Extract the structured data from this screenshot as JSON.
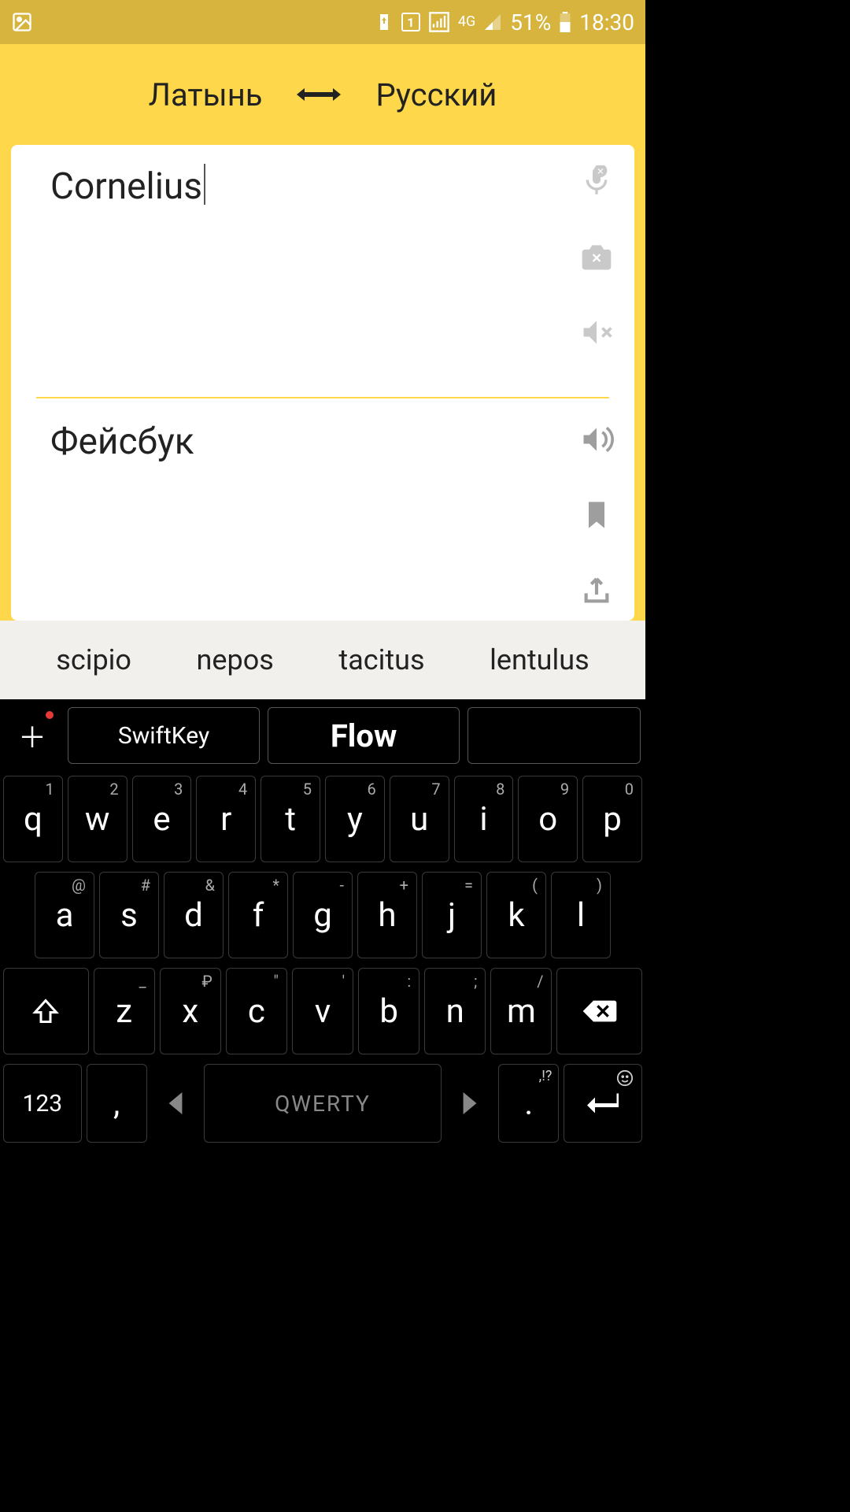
{
  "status": {
    "battery_pct": "51%",
    "time": "18:30",
    "network": "4G",
    "sim": "1"
  },
  "header": {
    "source_lang": "Латынь",
    "target_lang": "Русский"
  },
  "source": {
    "text": "Cornelius"
  },
  "target": {
    "text": "Фейсбук"
  },
  "suggestions": [
    "scipio",
    "nepos",
    "tacitus",
    "lentulus"
  ],
  "kb_top": {
    "brand": "SwiftKey",
    "mode": "Flow"
  },
  "rows": {
    "r1": [
      {
        "p": "q",
        "s": "1"
      },
      {
        "p": "w",
        "s": "2"
      },
      {
        "p": "e",
        "s": "3"
      },
      {
        "p": "r",
        "s": "4"
      },
      {
        "p": "t",
        "s": "5"
      },
      {
        "p": "y",
        "s": "6"
      },
      {
        "p": "u",
        "s": "7"
      },
      {
        "p": "i",
        "s": "8"
      },
      {
        "p": "o",
        "s": "9"
      },
      {
        "p": "p",
        "s": "0"
      }
    ],
    "r2": [
      {
        "p": "a",
        "s": "@"
      },
      {
        "p": "s",
        "s": "#"
      },
      {
        "p": "d",
        "s": "&"
      },
      {
        "p": "f",
        "s": "*"
      },
      {
        "p": "g",
        "s": "-"
      },
      {
        "p": "h",
        "s": "+"
      },
      {
        "p": "j",
        "s": "="
      },
      {
        "p": "k",
        "s": "("
      },
      {
        "p": "l",
        "s": ")"
      }
    ],
    "r3": [
      {
        "p": "z",
        "s": "_"
      },
      {
        "p": "x",
        "s": "₽"
      },
      {
        "p": "c",
        "s": "\""
      },
      {
        "p": "v",
        "s": "'"
      },
      {
        "p": "b",
        "s": ":"
      },
      {
        "p": "n",
        "s": ";"
      },
      {
        "p": "m",
        "s": "/"
      }
    ],
    "r4": {
      "num": "123",
      "comma": ",",
      "space": "QWERTY",
      "dot": ".",
      "dot_alt": ",!?"
    }
  }
}
